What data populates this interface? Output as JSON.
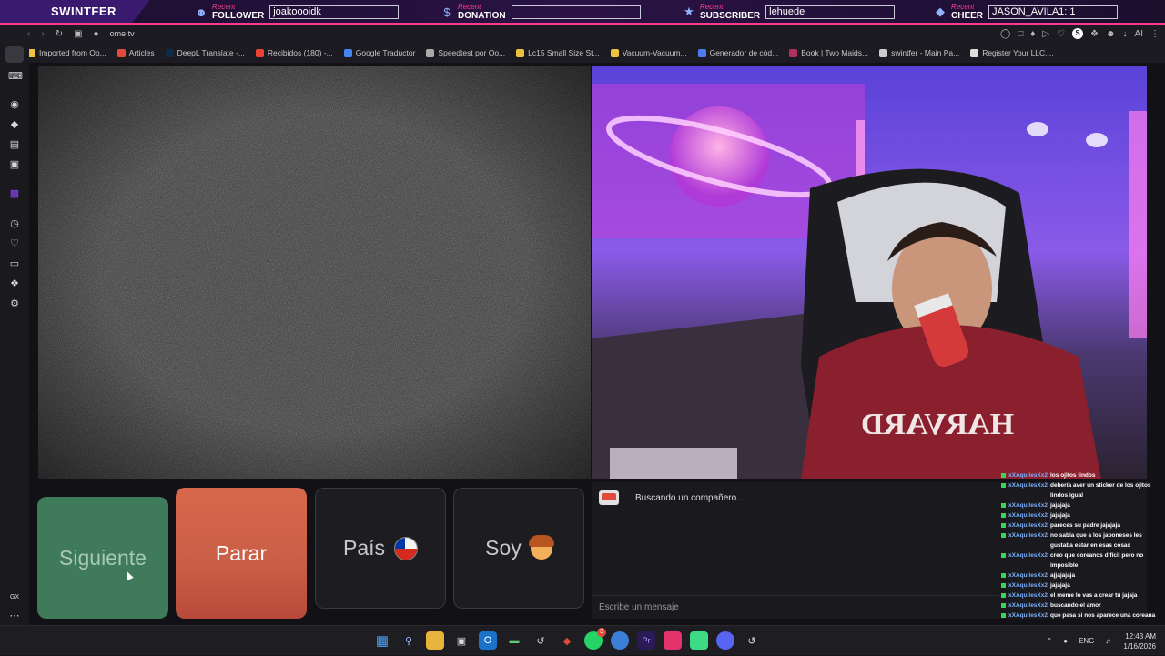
{
  "overlay": {
    "brand": "SWINTFER",
    "recent_label": "Recent",
    "follower": {
      "kind": "FOLLOWER",
      "value": "joakoooidk"
    },
    "donation": {
      "kind": "DONATION",
      "value": ""
    },
    "subscriber": {
      "kind": "SUBSCRIBER",
      "value": "lehuede"
    },
    "cheer": {
      "kind": "CHEER",
      "value": "JASON_AVILA1: 1"
    }
  },
  "browser": {
    "url": "ome.tv",
    "ai_label": "AI",
    "bookmarks": [
      {
        "label": "Imported from Op...",
        "color": "#f0c040"
      },
      {
        "label": "Articles",
        "color": "#e24b3b"
      },
      {
        "label": "DeepL Translate -...",
        "color": "#0f2b46"
      },
      {
        "label": "Recibidos (180) -...",
        "color": "#ea4335"
      },
      {
        "label": "Google Traductor",
        "color": "#4285f4"
      },
      {
        "label": "Speedtest por Oo...",
        "color": "#aaaaaa"
      },
      {
        "label": "Lc15 Small Size St...",
        "color": "#f0c040"
      },
      {
        "label": "Vacuum-Vacuum...",
        "color": "#f0c040"
      },
      {
        "label": "Generador de cód...",
        "color": "#4a7cf0"
      },
      {
        "label": "Book | Two Maids...",
        "color": "#b03060"
      },
      {
        "label": "swintfer - Main Pa...",
        "color": "#cccccc"
      },
      {
        "label": "Register Your LLC,...",
        "color": "#dddddd"
      }
    ]
  },
  "sidebar": {
    "bottom_label": "GX"
  },
  "buttons": {
    "next": "Siguiente",
    "stop": "Parar",
    "country": "País",
    "me": "Soy"
  },
  "chat": {
    "status": "Buscando un compañero...",
    "input_placeholder": "Escribe un mensaje"
  },
  "stream_chat": [
    {
      "user": "xXAquilesXx2",
      "msg": "los ojitos lindos"
    },
    {
      "user": "xXAquilesXx2",
      "msg": "debería aver un sticker de los ojitos lindos igual"
    },
    {
      "user": "xXAquilesXx2",
      "msg": "jajajaja"
    },
    {
      "user": "xXAquilesXx2",
      "msg": "jajajaja"
    },
    {
      "user": "xXAquilesXx2",
      "msg": "pareces su padre jajajaja"
    },
    {
      "user": "xXAquilesXx2",
      "msg": "no sabia que a los japoneses les gustaba estar en esas cosas"
    },
    {
      "user": "xXAquilesXx2",
      "msg": "creo que coreanos difícil pero no imposible"
    },
    {
      "user": "xXAquilesXx2",
      "msg": "ajjajajaja"
    },
    {
      "user": "xXAquilesXx2",
      "msg": "jajajaja"
    },
    {
      "user": "xXAquilesXx2",
      "msg": "el meme lo vas a crear tú jajaja"
    },
    {
      "user": "xXAquilesXx2",
      "msg": "buscando el amor"
    },
    {
      "user": "xXAquilesXx2",
      "msg": "que pasa si nos aparece una coreana"
    }
  ],
  "taskbar": {
    "lang": "ENG",
    "time": "12:43 AM",
    "date": "1/16/2026",
    "notification_count": "3"
  },
  "webcam": {
    "shirt_text": "HARVARD"
  }
}
